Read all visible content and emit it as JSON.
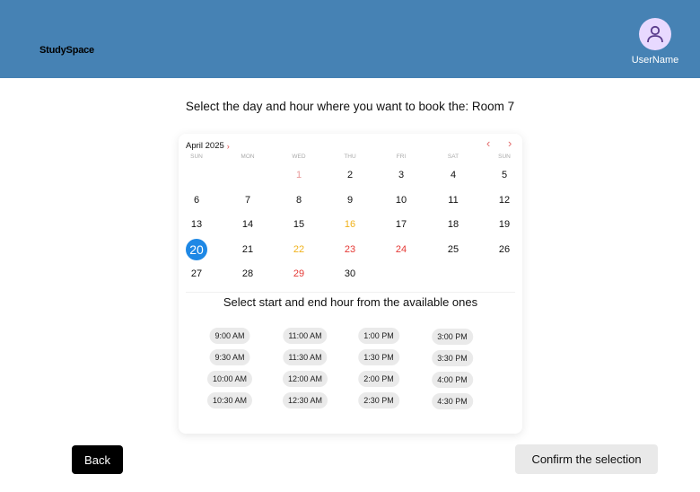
{
  "header": {
    "brand": "StudySpace",
    "username": "UserName",
    "bg_color": "#4682B4"
  },
  "instruction": "Select the day and hour where you want to book the: Room 7",
  "calendar": {
    "month_label": "April 2025",
    "month_chevron_icon": "chevron-right-icon",
    "prev_icon": "chevron-left-icon",
    "next_icon": "chevron-right-icon",
    "weekdays": [
      "SUN",
      "MON",
      "WED",
      "THU",
      "FRI",
      "SAT",
      "SUN"
    ],
    "weeks": [
      [
        null,
        null,
        {
          "d": "1",
          "s": "muted-red"
        },
        {
          "d": "2"
        },
        {
          "d": "3"
        },
        {
          "d": "4"
        },
        {
          "d": "5"
        }
      ],
      [
        {
          "d": "6"
        },
        {
          "d": "7"
        },
        {
          "d": "8"
        },
        {
          "d": "9"
        },
        {
          "d": "10"
        },
        {
          "d": "11"
        },
        {
          "d": "12"
        }
      ],
      [
        {
          "d": "13"
        },
        {
          "d": "14"
        },
        {
          "d": "15"
        },
        {
          "d": "16",
          "s": "yellow"
        },
        {
          "d": "17"
        },
        {
          "d": "18"
        },
        {
          "d": "19"
        }
      ],
      [
        {
          "d": "20",
          "s": "selected"
        },
        {
          "d": "21"
        },
        {
          "d": "22",
          "s": "yellow"
        },
        {
          "d": "23",
          "s": "red"
        },
        {
          "d": "24",
          "s": "red"
        },
        {
          "d": "25"
        },
        {
          "d": "26"
        }
      ],
      [
        {
          "d": "27"
        },
        {
          "d": "28"
        },
        {
          "d": "29",
          "s": "red"
        },
        {
          "d": "30"
        },
        null,
        null,
        null
      ]
    ],
    "selected_day": "20",
    "colors": {
      "selected": "#1e88e5",
      "unavailable": "#e53935",
      "partial": "#f0b21b"
    }
  },
  "hours": {
    "title": "Select start and end hour from the available ones",
    "columns": [
      [
        "9:00 AM",
        "9:30 AM",
        "10:00 AM",
        "10:30 AM"
      ],
      [
        "11:00 AM",
        "11:30 AM",
        "12:00 AM",
        "12:30 AM"
      ],
      [
        "1:00 PM",
        "1:30 PM",
        "2:00 PM",
        "2:30 PM"
      ],
      [
        "3:00 PM",
        "3:30 PM",
        "4:00 PM",
        "4:30 PM"
      ]
    ]
  },
  "actions": {
    "back_label": "Back",
    "confirm_label": "Confirm the selection"
  }
}
